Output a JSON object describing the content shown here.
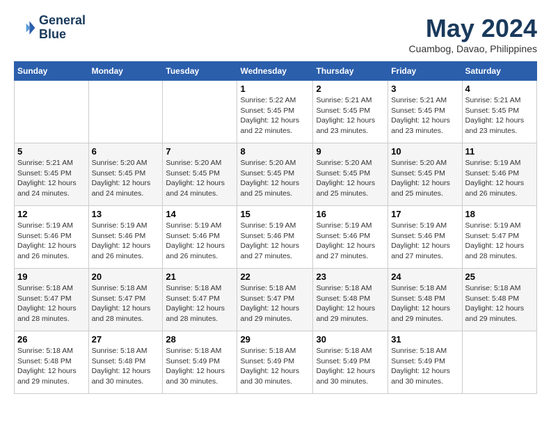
{
  "header": {
    "logo_line1": "General",
    "logo_line2": "Blue",
    "month_title": "May 2024",
    "location": "Cuambog, Davao, Philippines"
  },
  "days_of_week": [
    "Sunday",
    "Monday",
    "Tuesday",
    "Wednesday",
    "Thursday",
    "Friday",
    "Saturday"
  ],
  "weeks": [
    [
      {
        "num": "",
        "info": ""
      },
      {
        "num": "",
        "info": ""
      },
      {
        "num": "",
        "info": ""
      },
      {
        "num": "1",
        "info": "Sunrise: 5:22 AM\nSunset: 5:45 PM\nDaylight: 12 hours\nand 22 minutes."
      },
      {
        "num": "2",
        "info": "Sunrise: 5:21 AM\nSunset: 5:45 PM\nDaylight: 12 hours\nand 23 minutes."
      },
      {
        "num": "3",
        "info": "Sunrise: 5:21 AM\nSunset: 5:45 PM\nDaylight: 12 hours\nand 23 minutes."
      },
      {
        "num": "4",
        "info": "Sunrise: 5:21 AM\nSunset: 5:45 PM\nDaylight: 12 hours\nand 23 minutes."
      }
    ],
    [
      {
        "num": "5",
        "info": "Sunrise: 5:21 AM\nSunset: 5:45 PM\nDaylight: 12 hours\nand 24 minutes."
      },
      {
        "num": "6",
        "info": "Sunrise: 5:20 AM\nSunset: 5:45 PM\nDaylight: 12 hours\nand 24 minutes."
      },
      {
        "num": "7",
        "info": "Sunrise: 5:20 AM\nSunset: 5:45 PM\nDaylight: 12 hours\nand 24 minutes."
      },
      {
        "num": "8",
        "info": "Sunrise: 5:20 AM\nSunset: 5:45 PM\nDaylight: 12 hours\nand 25 minutes."
      },
      {
        "num": "9",
        "info": "Sunrise: 5:20 AM\nSunset: 5:45 PM\nDaylight: 12 hours\nand 25 minutes."
      },
      {
        "num": "10",
        "info": "Sunrise: 5:20 AM\nSunset: 5:45 PM\nDaylight: 12 hours\nand 25 minutes."
      },
      {
        "num": "11",
        "info": "Sunrise: 5:19 AM\nSunset: 5:46 PM\nDaylight: 12 hours\nand 26 minutes."
      }
    ],
    [
      {
        "num": "12",
        "info": "Sunrise: 5:19 AM\nSunset: 5:46 PM\nDaylight: 12 hours\nand 26 minutes."
      },
      {
        "num": "13",
        "info": "Sunrise: 5:19 AM\nSunset: 5:46 PM\nDaylight: 12 hours\nand 26 minutes."
      },
      {
        "num": "14",
        "info": "Sunrise: 5:19 AM\nSunset: 5:46 PM\nDaylight: 12 hours\nand 26 minutes."
      },
      {
        "num": "15",
        "info": "Sunrise: 5:19 AM\nSunset: 5:46 PM\nDaylight: 12 hours\nand 27 minutes."
      },
      {
        "num": "16",
        "info": "Sunrise: 5:19 AM\nSunset: 5:46 PM\nDaylight: 12 hours\nand 27 minutes."
      },
      {
        "num": "17",
        "info": "Sunrise: 5:19 AM\nSunset: 5:46 PM\nDaylight: 12 hours\nand 27 minutes."
      },
      {
        "num": "18",
        "info": "Sunrise: 5:19 AM\nSunset: 5:47 PM\nDaylight: 12 hours\nand 28 minutes."
      }
    ],
    [
      {
        "num": "19",
        "info": "Sunrise: 5:18 AM\nSunset: 5:47 PM\nDaylight: 12 hours\nand 28 minutes."
      },
      {
        "num": "20",
        "info": "Sunrise: 5:18 AM\nSunset: 5:47 PM\nDaylight: 12 hours\nand 28 minutes."
      },
      {
        "num": "21",
        "info": "Sunrise: 5:18 AM\nSunset: 5:47 PM\nDaylight: 12 hours\nand 28 minutes."
      },
      {
        "num": "22",
        "info": "Sunrise: 5:18 AM\nSunset: 5:47 PM\nDaylight: 12 hours\nand 29 minutes."
      },
      {
        "num": "23",
        "info": "Sunrise: 5:18 AM\nSunset: 5:48 PM\nDaylight: 12 hours\nand 29 minutes."
      },
      {
        "num": "24",
        "info": "Sunrise: 5:18 AM\nSunset: 5:48 PM\nDaylight: 12 hours\nand 29 minutes."
      },
      {
        "num": "25",
        "info": "Sunrise: 5:18 AM\nSunset: 5:48 PM\nDaylight: 12 hours\nand 29 minutes."
      }
    ],
    [
      {
        "num": "26",
        "info": "Sunrise: 5:18 AM\nSunset: 5:48 PM\nDaylight: 12 hours\nand 29 minutes."
      },
      {
        "num": "27",
        "info": "Sunrise: 5:18 AM\nSunset: 5:48 PM\nDaylight: 12 hours\nand 30 minutes."
      },
      {
        "num": "28",
        "info": "Sunrise: 5:18 AM\nSunset: 5:49 PM\nDaylight: 12 hours\nand 30 minutes."
      },
      {
        "num": "29",
        "info": "Sunrise: 5:18 AM\nSunset: 5:49 PM\nDaylight: 12 hours\nand 30 minutes."
      },
      {
        "num": "30",
        "info": "Sunrise: 5:18 AM\nSunset: 5:49 PM\nDaylight: 12 hours\nand 30 minutes."
      },
      {
        "num": "31",
        "info": "Sunrise: 5:18 AM\nSunset: 5:49 PM\nDaylight: 12 hours\nand 30 minutes."
      },
      {
        "num": "",
        "info": ""
      }
    ]
  ]
}
